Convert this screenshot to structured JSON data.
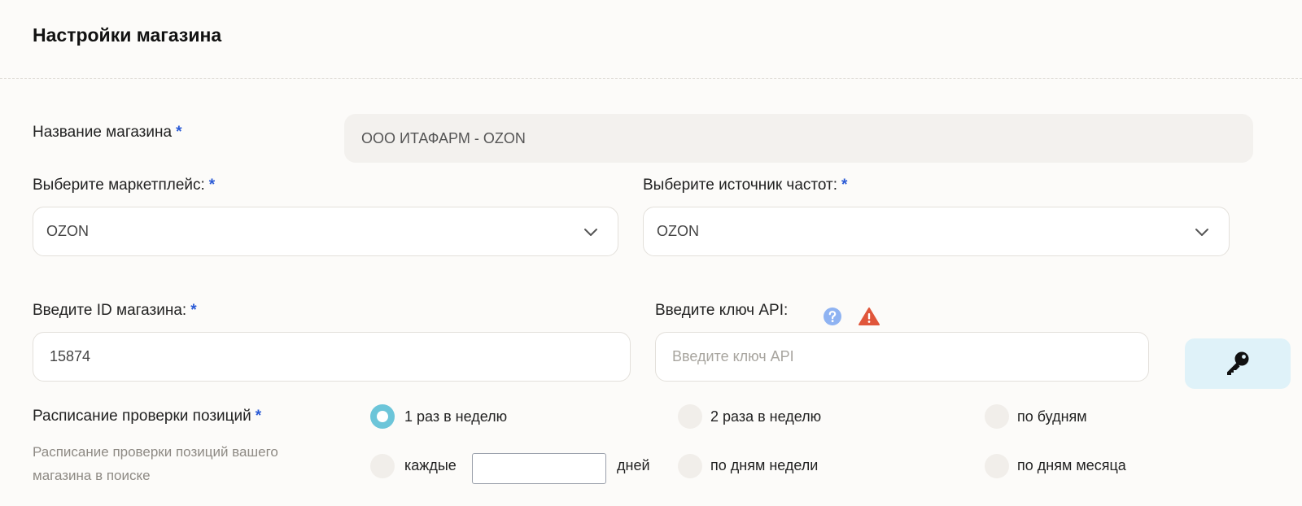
{
  "header": {
    "title": "Настройки магазина"
  },
  "form": {
    "required_mark": "*",
    "store_name": {
      "label": "Название магазина",
      "value": "ООО ИТАФАРМ - OZON"
    },
    "marketplace": {
      "label": "Выберите маркетплейс:",
      "value": "OZON"
    },
    "frequency_source": {
      "label": "Выберите источник частот:",
      "value": "OZON"
    },
    "store_id": {
      "label": "Введите ID магазина:",
      "value": "15874"
    },
    "api_key": {
      "label": "Введите ключ API:",
      "value": "",
      "placeholder": "Введите ключ API"
    },
    "schedule": {
      "label": "Расписание проверки позиций",
      "sublabel": "Расписание проверки позиций вашего магазина в поиске",
      "selected": "once_week",
      "options": {
        "once_week": "1 раз в неделю",
        "twice_week": "2 раза в неделю",
        "weekdays": "по будням",
        "every_prefix": "каждые",
        "every_suffix": "дней",
        "week_days": "по дням недели",
        "month_days": "по дням месяца"
      },
      "every_days_value": ""
    }
  },
  "colors": {
    "accent_radio": "#6cc5d9",
    "required": "#2b5bd6",
    "key_button_bg": "#dff2f9",
    "warning": "#e0563b",
    "help": "#8fb3f2"
  },
  "icons": {
    "select_chevron": "chevron-down-icon",
    "help": "question-circle-icon",
    "warning": "warning-triangle-icon",
    "key_button": "key-icon"
  }
}
